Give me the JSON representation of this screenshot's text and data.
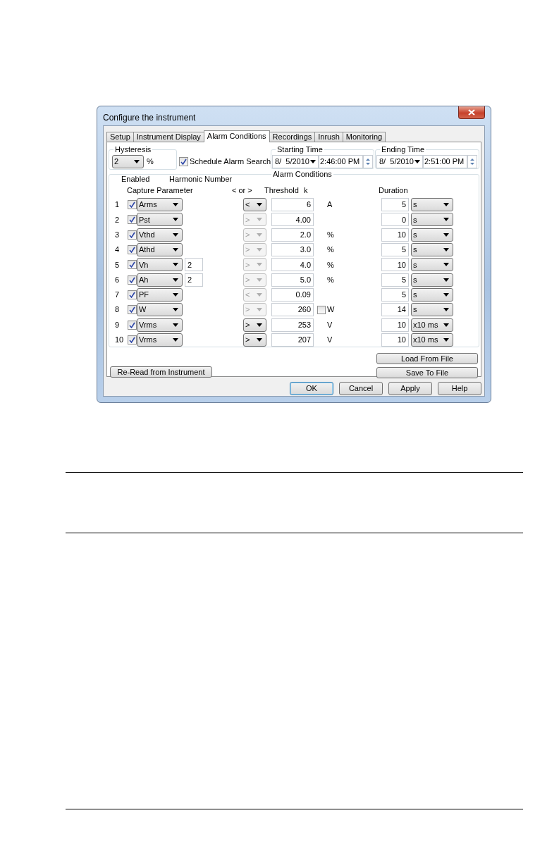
{
  "window": {
    "title": "Configure the instrument"
  },
  "tabs": [
    {
      "label": "Setup",
      "selected": false
    },
    {
      "label": "Instrument Display",
      "selected": false
    },
    {
      "label": "Alarm Conditions",
      "selected": true
    },
    {
      "label": "Recordings",
      "selected": false
    },
    {
      "label": "Inrush",
      "selected": false
    },
    {
      "label": "Monitoring",
      "selected": false
    }
  ],
  "hysteresis": {
    "legend": "Hysteresis",
    "value": "2",
    "unit": "%"
  },
  "schedule_alarm_search": {
    "label": "Schedule Alarm Search",
    "checked": true
  },
  "starting_time": {
    "legend": "Starting Time",
    "date": "8/  5/2010",
    "time": "2:46:00 PM"
  },
  "ending_time": {
    "legend": "Ending Time",
    "date": "8/  5/2010",
    "time": "2:51:00 PM"
  },
  "alarm_conditions": {
    "legend": "Alarm Conditions",
    "headers": {
      "enabled": "Enabled",
      "harmonic_number": "Harmonic Number",
      "capture_parameter": "Capture Parameter",
      "operator": "< or >",
      "threshold": "Threshold",
      "k": "k",
      "duration": "Duration"
    },
    "rows": [
      {
        "number": "1",
        "enabled": true,
        "parameter": "Arms",
        "operator": "<",
        "operator_disabled": false,
        "threshold": "6",
        "unit": "A",
        "duration": "5",
        "duration_unit": "s"
      },
      {
        "number": "2",
        "enabled": true,
        "parameter": "Pst",
        "operator": ">",
        "operator_disabled": true,
        "threshold": "4.00",
        "duration": "0",
        "duration_unit": "s"
      },
      {
        "number": "3",
        "enabled": true,
        "parameter": "Vthd",
        "operator": ">",
        "operator_disabled": true,
        "threshold": "2.0",
        "unit": "%",
        "duration": "10",
        "duration_unit": "s"
      },
      {
        "number": "4",
        "enabled": true,
        "parameter": "Athd",
        "operator": ">",
        "operator_disabled": true,
        "threshold": "3.0",
        "unit": "%",
        "duration": "5",
        "duration_unit": "s"
      },
      {
        "number": "5",
        "enabled": true,
        "parameter": "Vh",
        "harmonic": "2",
        "operator": ">",
        "operator_disabled": true,
        "threshold": "4.0",
        "unit": "%",
        "duration": "10",
        "duration_unit": "s"
      },
      {
        "number": "6",
        "enabled": true,
        "parameter": "Ah",
        "harmonic": "2",
        "operator": ">",
        "operator_disabled": true,
        "threshold": "5.0",
        "unit": "%",
        "duration": "5",
        "duration_unit": "s"
      },
      {
        "number": "7",
        "enabled": true,
        "parameter": "PF",
        "operator": "<",
        "operator_disabled": true,
        "threshold": "0.09",
        "duration": "5",
        "duration_unit": "s"
      },
      {
        "number": "8",
        "enabled": true,
        "parameter": "W",
        "operator": ">",
        "operator_disabled": true,
        "threshold": "260",
        "k_checked": false,
        "unit": "W",
        "duration": "14",
        "duration_unit": "s"
      },
      {
        "number": "9",
        "enabled": true,
        "parameter": "Vrms",
        "operator": ">",
        "operator_disabled": false,
        "threshold": "253",
        "unit": "V",
        "duration": "10",
        "duration_unit": "x10 ms"
      },
      {
        "number": "10",
        "enabled": true,
        "parameter": "Vrms",
        "operator": ">",
        "operator_disabled": false,
        "threshold": "207",
        "unit": "V",
        "duration": "10",
        "duration_unit": "x10 ms"
      }
    ]
  },
  "file_buttons": {
    "load": "Load From File",
    "save": "Save To File",
    "reread": "Re-Read from Instrument"
  },
  "dialog_buttons": [
    {
      "label": "OK",
      "default": true
    },
    {
      "label": "Cancel",
      "default": false
    },
    {
      "label": "Apply",
      "default": false
    },
    {
      "label": "Help",
      "default": false
    }
  ]
}
